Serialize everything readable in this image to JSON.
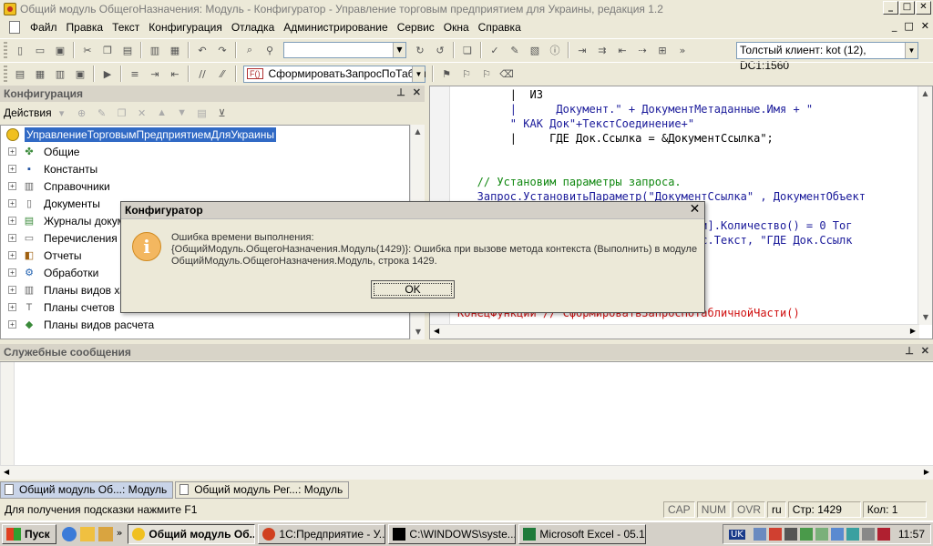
{
  "window": {
    "title": "Общий модуль ОбщегоНазначения: Модуль - Конфигуратор - Управление торговым предприятием для Украины, редакция 1.2",
    "min": "_",
    "max": "□",
    "close": "✕"
  },
  "menu": {
    "items": [
      "Файл",
      "Правка",
      "Текст",
      "Конфигурация",
      "Отладка",
      "Администрирование",
      "Сервис",
      "Окна",
      "Справка"
    ],
    "mdi_min": "_",
    "mdi_restore": "□",
    "mdi_close": "✕"
  },
  "toolbar": {
    "client_mode": "Толстый клиент: kot (12), DC1:1560",
    "procedure": "СформироватьЗапросПоТабли",
    "proc_badge": "F()"
  },
  "config_panel": {
    "title": "Конфигурация",
    "actions_label": "Действия",
    "root": "УправлениеТорговымПредприятиемДляУкраины",
    "items": [
      "Общие",
      "Константы",
      "Справочники",
      "Документы",
      "Журналы докумен",
      "Перечисления",
      "Отчеты",
      "Обработки",
      "Планы видов хар",
      "Планы счетов",
      "Планы видов расчета"
    ]
  },
  "code": {
    "lines": [
      "        |  ИЗ",
      "        |      Документ.\" + ДокументМетаданные.Имя + \"",
      "        \" КАК Док\"+ТекстСоединение+\"",
      "        |     ГДЕ Док.Ссылка = &ДокументСсылка\";",
      "",
      "",
      "   // Установим параметры запроса.",
      "   Запрос.УстановитьПараметр(\"ДокументСсылка\" , ДокументОбъект",
      "",
      "                              нойЧасти].Количество() = 0 Тог",
      "                              .(Запрос.Текст, \"ГДЕ Док.Ссылк",
      "",
      "",
      "",
      "",
      "КонецФункции // СформироватьЗапросПоТабличнойЧасти()"
    ]
  },
  "messages_panel": {
    "title": "Служебные сообщения"
  },
  "window_tabs": [
    "Общий модуль Об...: Модуль",
    "Общий модуль Рег...: Модуль"
  ],
  "status": {
    "hint": "Для получения подсказки нажмите F1",
    "cap": "CAP",
    "num": "NUM",
    "ovr": "OVR",
    "lang": "ru",
    "line": "Стр: 1429",
    "col": "Кол: 1"
  },
  "taskbar": {
    "start": "Пуск",
    "more": "»",
    "items": [
      "Общий модуль Об...",
      "1С:Предприятие - У...",
      "C:\\WINDOWS\\syste...",
      "Microsoft Excel - 05.1..."
    ],
    "lang": "UK",
    "clock": "11:57"
  },
  "dialog": {
    "title": "Конфигуратор",
    "icon_char": "i",
    "close": "✕",
    "line1": "Ошибка времени выполнения:",
    "line2": "{ОбщийМодуль.ОбщегоНазначения.Модуль(1429)}: Ошибка при вызове метода контекста (Выполнить) в модуле",
    "line3": "ОбщийМодуль.ОбщегоНазначения.Модуль, строка 1429.",
    "ok": "OK"
  },
  "colors": {
    "selection": "#316ac5",
    "keyword": "#d01010",
    "identifier": "#1a1a9a",
    "comment": "#118811"
  }
}
